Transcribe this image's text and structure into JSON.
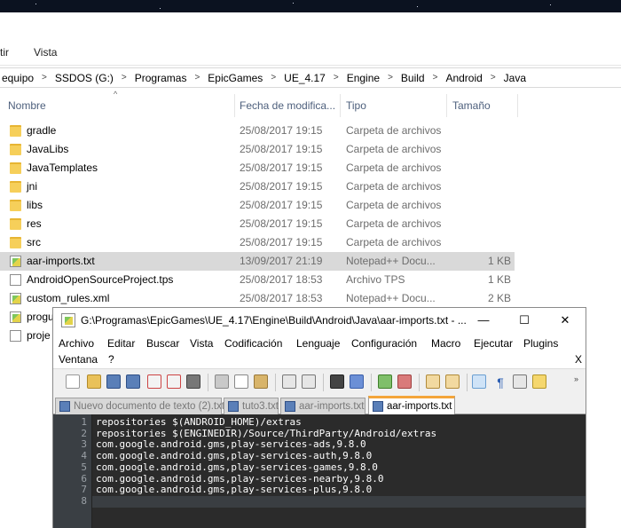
{
  "explorer": {
    "ribbon_tabs": [
      "tir",
      "Vista"
    ],
    "breadcrumb": [
      "equipo",
      "SSDOS (G:)",
      "Programas",
      "EpicGames",
      "UE_4.17",
      "Engine",
      "Build",
      "Android",
      "Java"
    ],
    "columns": {
      "name": "Nombre",
      "date": "Fecha de modifica...",
      "type": "Tipo",
      "size": "Tamaño"
    },
    "files": [
      {
        "icon": "folder-icon",
        "name": "gradle",
        "date": "25/08/2017 19:15",
        "type": "Carpeta de archivos",
        "size": ""
      },
      {
        "icon": "folder-icon",
        "name": "JavaLibs",
        "date": "25/08/2017 19:15",
        "type": "Carpeta de archivos",
        "size": ""
      },
      {
        "icon": "folder-icon",
        "name": "JavaTemplates",
        "date": "25/08/2017 19:15",
        "type": "Carpeta de archivos",
        "size": ""
      },
      {
        "icon": "folder-icon",
        "name": "jni",
        "date": "25/08/2017 19:15",
        "type": "Carpeta de archivos",
        "size": ""
      },
      {
        "icon": "folder-icon",
        "name": "libs",
        "date": "25/08/2017 19:15",
        "type": "Carpeta de archivos",
        "size": ""
      },
      {
        "icon": "folder-icon",
        "name": "res",
        "date": "25/08/2017 19:15",
        "type": "Carpeta de archivos",
        "size": ""
      },
      {
        "icon": "folder-icon",
        "name": "src",
        "date": "25/08/2017 19:15",
        "type": "Carpeta de archivos",
        "size": ""
      },
      {
        "icon": "notepadpp-file-icon",
        "name": "aar-imports.txt",
        "date": "13/09/2017 21:19",
        "type": "Notepad++ Docu...",
        "size": "1 KB",
        "selected": true
      },
      {
        "icon": "document-icon",
        "name": "AndroidOpenSourceProject.tps",
        "date": "25/08/2017 18:53",
        "type": "Archivo TPS",
        "size": "1 KB"
      },
      {
        "icon": "notepadpp-file-icon",
        "name": "custom_rules.xml",
        "date": "25/08/2017 18:53",
        "type": "Notepad++ Docu...",
        "size": "2 KB"
      },
      {
        "icon": "notepadpp-file-icon",
        "name": "progu",
        "date": "",
        "type": "",
        "size": ""
      },
      {
        "icon": "document-icon",
        "name": "proje",
        "date": "",
        "type": "",
        "size": ""
      }
    ]
  },
  "notepad": {
    "title": "G:\\Programas\\EpicGames\\UE_4.17\\Engine\\Build\\Android\\Java\\aar-imports.txt - ...",
    "window_buttons": {
      "minimize": "—",
      "maximize": "☐",
      "close": "✕"
    },
    "menu_row1": [
      "Archivo",
      "Editar",
      "Buscar",
      "Vista",
      "Codificación",
      "Lenguaje",
      "Configuración",
      "Macro",
      "Ejecutar",
      "Plugins"
    ],
    "menu_row2": [
      "Ventana",
      "?"
    ],
    "menu_close": "X",
    "tabs": [
      "Nuevo documento de texto (2).txt",
      "tuto3.txt",
      "aar-imports.txt",
      "aar-imports.txt"
    ],
    "active_tab": 3,
    "lines": [
      "repositories $(ANDROID_HOME)/extras",
      "repositories $(ENGINEDIR)/Source/ThirdParty/Android/extras",
      "com.google.android.gms,play-services-ads,9.8.0",
      "com.google.android.gms,play-services-auth,9.8.0",
      "com.google.android.gms,play-services-games,9.8.0",
      "com.google.android.gms,play-services-nearby,9.8.0",
      "com.google.android.gms,play-services-plus,9.8.0",
      ""
    ],
    "line_numbers": [
      "1",
      "2",
      "3",
      "4",
      "5",
      "6",
      "7",
      "8"
    ],
    "current_line": 8,
    "colors": {
      "editor_bg": "#2b2b2b",
      "gutter_bg": "#3a3f44",
      "tab_accent": "#f4a53a"
    }
  }
}
